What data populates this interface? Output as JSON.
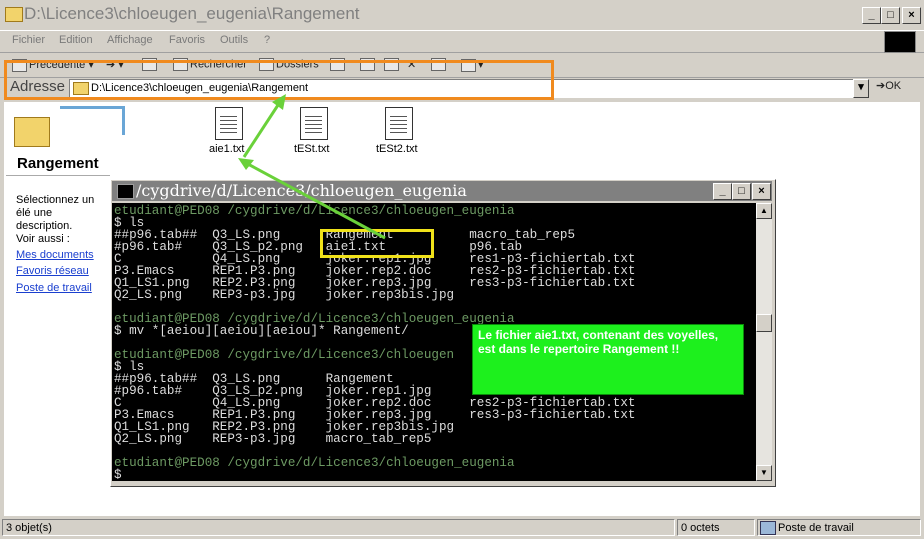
{
  "window": {
    "title": "D:\\Licence3\\chloeugen_eugenia\\Rangement",
    "btn_min": "_",
    "btn_max": "□",
    "btn_close": "×"
  },
  "menu": [
    "Fichier",
    "Edition",
    "Affichage",
    "Favoris",
    "Outils",
    "?"
  ],
  "toolbar": {
    "back": "Précédente",
    "search": "Rechercher",
    "folders": "Dossiers"
  },
  "address": {
    "label": "Adresse",
    "path": "D:\\Licence3\\chloeugen_eugenia\\Rangement",
    "go": "OK"
  },
  "left_pane": {
    "folder_name": "Rangement",
    "description": "Sélectionnez un élé une description.",
    "see_also": "Voir aussi :",
    "links": [
      "Mes documents",
      "Favoris réseau",
      "Poste de travail"
    ]
  },
  "files": [
    "aie1.txt",
    "tESt.txt",
    "tESt2.txt"
  ],
  "status": {
    "objects": "3 objet(s)",
    "size": "0 octets",
    "location": "Poste de travail"
  },
  "terminal": {
    "title": "/cygdrive/d/Licence3/chloeugen_eugenia",
    "lines": [
      {
        "text": "etudiant@PED08 /cygdrive/d/Licence3/chloeugen_eugenia",
        "style": "green"
      },
      {
        "text": "$ ls",
        "style": "white"
      },
      {
        "text": "##p96.tab##  Q3_LS.png      Rangement          macro_tab_rep5",
        "style": "white"
      },
      {
        "text": "#p96.tab#    Q3_LS_p2.png   aie1.txt           p96.tab",
        "style": "white"
      },
      {
        "text": "C            Q4_LS.png      joker.rep1.jpg     res1-p3-fichiertab.txt",
        "style": "white"
      },
      {
        "text": "P3.Emacs     REP1.P3.png    joker.rep2.doc     res2-p3-fichiertab.txt",
        "style": "white"
      },
      {
        "text": "Q1_LS1.png   REP2.P3.png    joker.rep3.jpg     res3-p3-fichiertab.txt",
        "style": "white"
      },
      {
        "text": "Q2_LS.png    REP3-p3.jpg    joker.rep3bis.jpg",
        "style": "white"
      },
      {
        "text": "",
        "style": "white"
      },
      {
        "text": "etudiant@PED08 /cygdrive/d/Licence3/chloeugen_eugenia",
        "style": "green"
      },
      {
        "text": "$ mv *[aeiou][aeiou][aeiou]* Rangement/",
        "style": "white"
      },
      {
        "text": "",
        "style": "white"
      },
      {
        "text": "etudiant@PED08 /cygdrive/d/Licence3/chloeugen",
        "style": "green"
      },
      {
        "text": "$ ls",
        "style": "white"
      },
      {
        "text": "##p96.tab##  Q3_LS.png      Rangement",
        "style": "white"
      },
      {
        "text": "#p96.tab#    Q3_LS_p2.png   joker.rep1.jpg",
        "style": "white"
      },
      {
        "text": "C            Q4_LS.png      joker.rep2.doc     res2-p3-fichiertab.txt",
        "style": "white"
      },
      {
        "text": "P3.Emacs     REP1.P3.png    joker.rep3.jpg     res3-p3-fichiertab.txt",
        "style": "white"
      },
      {
        "text": "Q1_LS1.png   REP2.P3.png    joker.rep3bis.jpg",
        "style": "white"
      },
      {
        "text": "Q2_LS.png    REP3-p3.jpg    macro_tab_rep5",
        "style": "white"
      },
      {
        "text": "",
        "style": "white"
      },
      {
        "text": "etudiant@PED08 /cygdrive/d/Licence3/chloeugen_eugenia",
        "style": "green"
      },
      {
        "text": "$",
        "style": "white"
      }
    ]
  },
  "annotation": {
    "note": "Le fichier aie1.txt, contenant des voyelles, est dans le repertoire Rangement !!",
    "box_color": "#f0e21a",
    "note_color": "#1df01d",
    "address_highlight_color": "#f08a1e",
    "arrow_color": "#6ad13a"
  }
}
